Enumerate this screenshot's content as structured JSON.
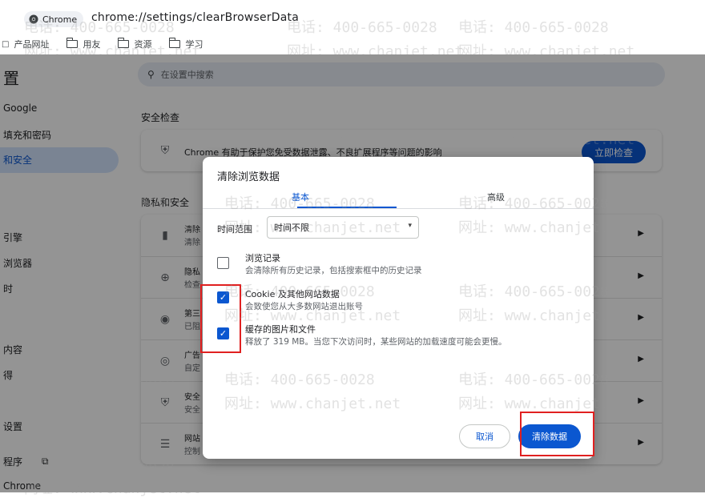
{
  "browser": {
    "tab_label": "Chrome",
    "url": "chrome://settings/clearBrowserData",
    "bookmarks": [
      {
        "label": "产品网址"
      },
      {
        "label": "用友"
      },
      {
        "label": "资源"
      },
      {
        "label": "学习"
      }
    ]
  },
  "settings": {
    "sidebar_title": "置",
    "search_placeholder": "在设置中搜索",
    "nav": [
      {
        "label": "Google"
      },
      {
        "label": "填充和密码"
      },
      {
        "label": "和安全"
      },
      {
        "label": "引擎"
      },
      {
        "label": "浏览器"
      },
      {
        "label": "时"
      },
      {
        "label": "内容"
      },
      {
        "label": "得"
      },
      {
        "label": "设置"
      },
      {
        "label": "程序"
      },
      {
        "label": "Chrome"
      }
    ],
    "safety_check": {
      "title": "安全检查",
      "description": "Chrome 有助于保护您免受数据泄露、不良扩展程序等问题的影响",
      "button": "立即检查"
    },
    "privacy": {
      "title": "隐私和安全",
      "rows": [
        {
          "t1": "清除",
          "t2": "清除"
        },
        {
          "t1": "隐私",
          "t2": "检查"
        },
        {
          "t1": "第三",
          "t2": "已阻"
        },
        {
          "t1": "广告",
          "t2": "自定"
        },
        {
          "t1": "安全",
          "t2": "安全"
        },
        {
          "t1": "网站",
          "t2": "控制"
        }
      ]
    }
  },
  "dialog": {
    "title": "清除浏览数据",
    "tabs": {
      "basic": "基本",
      "advanced": "高级"
    },
    "time_range": {
      "label": "时间范围",
      "value": "时间不限"
    },
    "options": [
      {
        "title": "浏览记录",
        "desc": "会清除所有历史记录，包括搜索框中的历史记录",
        "checked": false
      },
      {
        "title": "Cookie 及其他网站数据",
        "desc": "会致使您从大多数网站退出账号",
        "checked": true
      },
      {
        "title": "缓存的图片和文件",
        "desc": "释放了 319 MB。当您下次访问时，某些网站的加载速度可能会更慢。",
        "checked": true
      }
    ],
    "cancel": "取消",
    "clear": "清除数据"
  },
  "watermark": {
    "phone": "电话: 400-665-0028",
    "site": "网址: www.chanjet.net"
  },
  "colors": {
    "accent": "#0b57d0",
    "highlight": "#e02020"
  }
}
